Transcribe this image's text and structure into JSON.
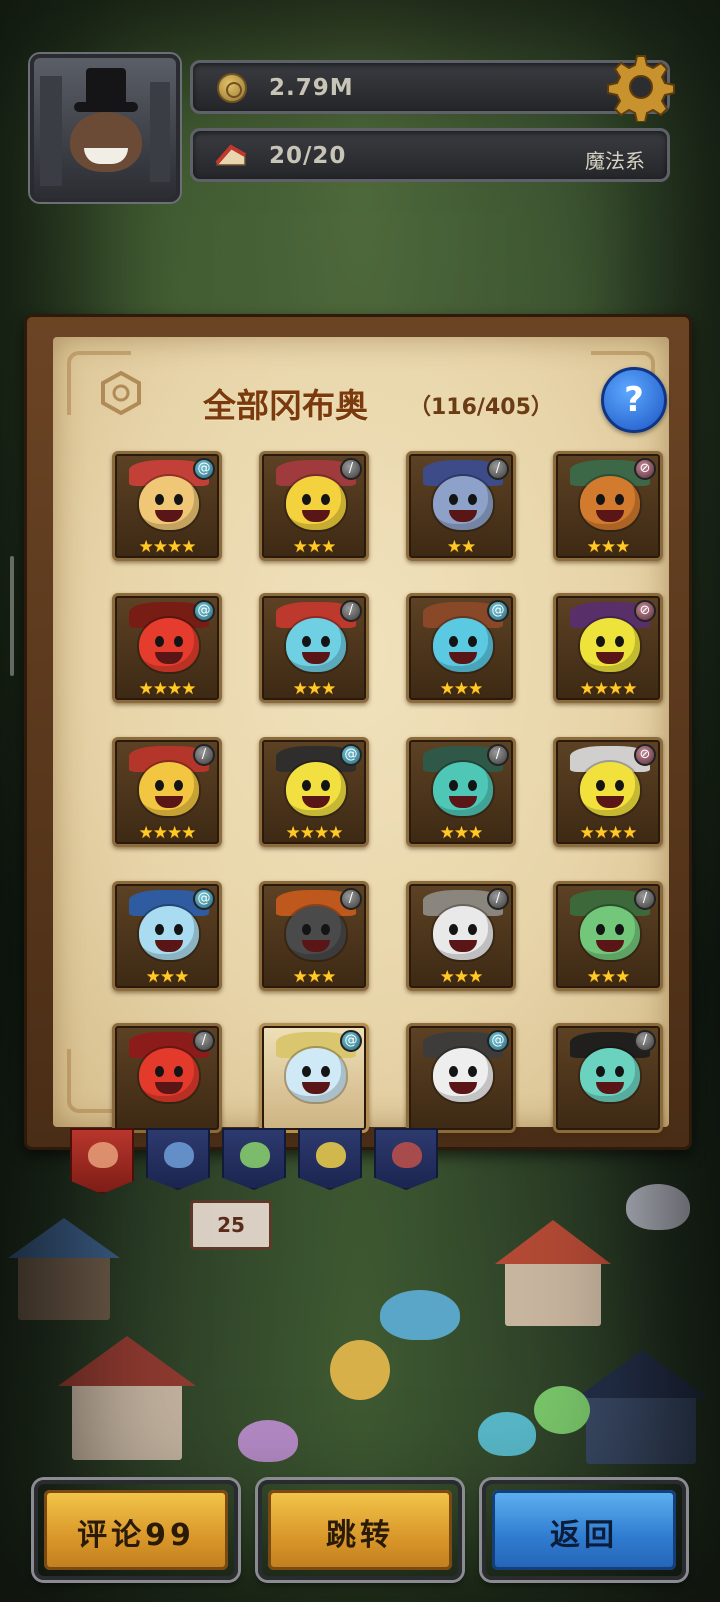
{
  "header": {
    "coins": "2.79M",
    "energy": "20/20",
    "element": "魔法系"
  },
  "panel": {
    "title": "全部冈布奥",
    "count": "（116/405）",
    "help_label": "?"
  },
  "grid": [
    {
      "stars": "★★★★",
      "badge": "swirl",
      "color": "#f0c777",
      "deco": "#c9403a",
      "light": false
    },
    {
      "stars": "★★★",
      "badge": "sword",
      "color": "#f3d23e",
      "deco": "#a33a3f",
      "light": false
    },
    {
      "stars": "★★",
      "badge": "sword",
      "color": "#8ea2c9",
      "deco": "#3c4c8f",
      "light": false
    },
    {
      "stars": "★★★",
      "badge": "ward",
      "color": "#d27a2e",
      "deco": "#3c6a4a",
      "light": false
    },
    {
      "stars": "★★★★",
      "badge": "swirl",
      "color": "#e53c2d",
      "deco": "#7a1b14",
      "light": false
    },
    {
      "stars": "★★★",
      "badge": "sword",
      "color": "#6fd0e4",
      "deco": "#c4392e",
      "light": false
    },
    {
      "stars": "★★★",
      "badge": "swirl",
      "color": "#5bc9e2",
      "deco": "#8c4a2a",
      "light": false
    },
    {
      "stars": "★★★★",
      "badge": "ward",
      "color": "#ede33a",
      "deco": "#5a2e6e",
      "light": false
    },
    {
      "stars": "★★★★",
      "badge": "sword",
      "color": "#f2c640",
      "deco": "#b9362b",
      "light": false
    },
    {
      "stars": "★★★★",
      "badge": "swirl",
      "color": "#f2e041",
      "deco": "#2d2d2d",
      "light": false
    },
    {
      "stars": "★★★",
      "badge": "sword",
      "color": "#4fc7b6",
      "deco": "#2d5a4c",
      "light": false
    },
    {
      "stars": "★★★★",
      "badge": "ward",
      "color": "#f2e13c",
      "deco": "#d7d7d7",
      "light": false
    },
    {
      "stars": "★★★",
      "badge": "swirl",
      "color": "#a9dcf0",
      "deco": "#2d5ea8",
      "light": false
    },
    {
      "stars": "★★★",
      "badge": "sword",
      "color": "#4a4a4a",
      "deco": "#c45a1e",
      "light": false
    },
    {
      "stars": "★★★",
      "badge": "sword",
      "color": "#e9e9e9",
      "deco": "#8d8a84",
      "light": false
    },
    {
      "stars": "★★★",
      "badge": "sword",
      "color": "#72c77a",
      "deco": "#3c6b3c",
      "light": false
    },
    {
      "stars": "",
      "badge": "sword",
      "color": "#e33a2b",
      "deco": "#8e1a1a",
      "light": false
    },
    {
      "stars": "",
      "badge": "swirl",
      "color": "#cfe9f6",
      "deco": "#d8c56a",
      "light": true
    },
    {
      "stars": "",
      "badge": "swirl",
      "color": "#eeeeee",
      "deco": "#3c3c3c",
      "light": false
    },
    {
      "stars": "",
      "badge": "sword",
      "color": "#6bd2c0",
      "deco": "#1e1e1e",
      "light": false
    }
  ],
  "tabs": [
    {
      "name": "tab-all",
      "color": "#e8a07a",
      "active": true
    },
    {
      "name": "tab-blue",
      "color": "#6f9fd8",
      "active": false
    },
    {
      "name": "tab-green",
      "color": "#8bd36b",
      "active": false
    },
    {
      "name": "tab-gold",
      "color": "#f0d04a",
      "active": false
    },
    {
      "name": "tab-red",
      "color": "#c0504a",
      "active": false
    }
  ],
  "village": {
    "sign_number": "25"
  },
  "buttons": {
    "comment": "评论99",
    "jump": "跳转",
    "back": "返回"
  },
  "colors": {
    "gold_button": "#e0a52f",
    "blue_button": "#3a8ad9",
    "title": "#7a3a0e",
    "star": "#ffc928"
  }
}
